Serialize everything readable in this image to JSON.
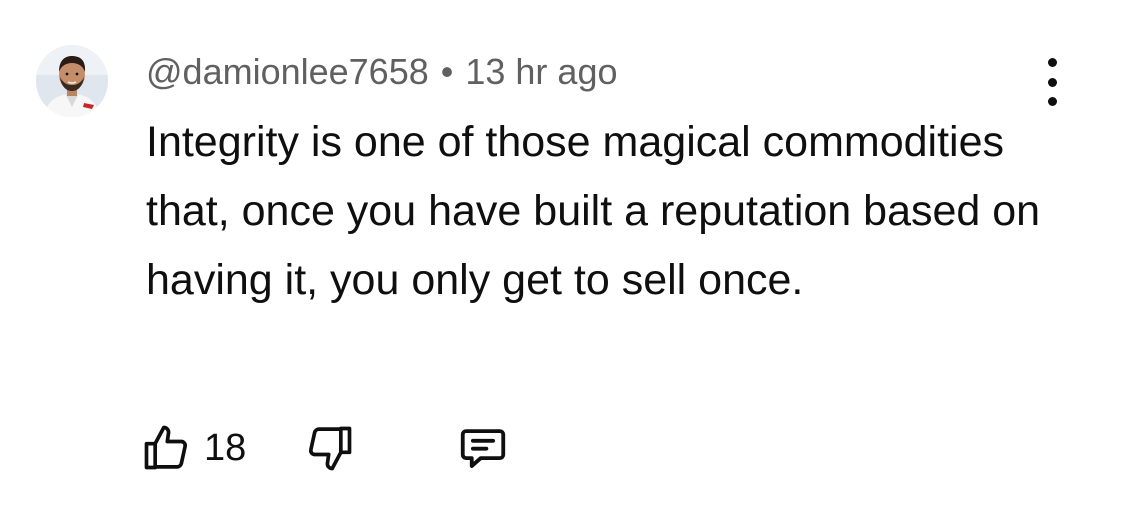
{
  "comment": {
    "author": "@damionlee7658",
    "separator": "•",
    "time": "13 hr ago",
    "text": "Integrity is one of those magical commodities that, once you have built a reputation based on having it, you only get to sell once.",
    "like_count": "18"
  },
  "icons": {
    "like": "thumbs-up-icon",
    "dislike": "thumbs-down-icon",
    "reply": "reply-comment-icon",
    "more": "more-vertical-icon"
  },
  "colors": {
    "text": "#0f0f0f",
    "meta": "#606060",
    "background": "#ffffff"
  }
}
